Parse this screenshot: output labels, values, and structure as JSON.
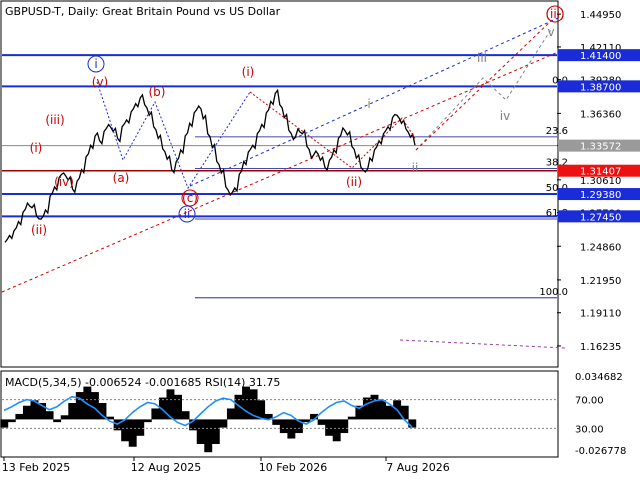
{
  "window": {
    "symbol_title": "GBPUSD-T, Daily:  Great Britain Pound vs US Dollar",
    "indicator_title": "MACD(5,34,5) -0.006524 -0.001685 RSI(14) 31.75"
  },
  "colors": {
    "background": "#ffffff",
    "frame": "#000000",
    "price_line": "#000000",
    "blue_wave": "#1a2bd8",
    "red_wave": "#cc0000",
    "gray_wave": "#808080",
    "fib_line": "#0a0a8a",
    "red_tag": "#ee1111",
    "macd_bars": "#000000",
    "rsi_line": "#1e90ff"
  },
  "chart_data": [
    {
      "type": "line",
      "name": "price",
      "y_axis_ticks": [
        "1.44950",
        "1.42110",
        "1.39280",
        "1.36360",
        "1.33570",
        "1.30610",
        "1.27780",
        "1.24860",
        "1.21950",
        "1.19110",
        "1.16235"
      ],
      "y_axis_range": [
        1.145,
        1.46
      ],
      "x_axis_ticks": [
        "13 Feb 2025",
        "12 Aug 2025",
        "10 Feb 2026",
        "7 Aug 2026"
      ],
      "price_tags": [
        {
          "value": 1.414,
          "label": "1.41400",
          "style": "blue"
        },
        {
          "value": 1.387,
          "label": "1.38700",
          "style": "blue"
        },
        {
          "value": 1.3357,
          "label": "1.33572",
          "style": "gray"
        },
        {
          "value": 1.314,
          "label": "1.31407",
          "style": "red"
        },
        {
          "value": 1.2938,
          "label": "1.29380",
          "style": "blue"
        },
        {
          "value": 1.2745,
          "label": "1.27450",
          "style": "blue"
        }
      ],
      "fib_levels": [
        {
          "label": "0.0",
          "value": 1.387
        },
        {
          "label": "23.6",
          "value": 1.3433
        },
        {
          "label": "38.2",
          "value": 1.316
        },
        {
          "label": "50.0",
          "value": 1.2938
        },
        {
          "label": "61.8",
          "value": 1.2722
        },
        {
          "label": "100.0",
          "value": 1.204
        }
      ],
      "wave_labels": [
        {
          "text": "i",
          "style": "blue-circle"
        },
        {
          "text": "ii",
          "style": "blue-circle"
        },
        {
          "text": "(i)",
          "style": "red"
        },
        {
          "text": "(ii)",
          "style": "red"
        },
        {
          "text": "(iii)",
          "style": "red"
        },
        {
          "text": "(iv)",
          "style": "red"
        },
        {
          "text": "(v)",
          "style": "red"
        },
        {
          "text": "(a)",
          "style": "red"
        },
        {
          "text": "(b)",
          "style": "red"
        },
        {
          "text": "(c)",
          "style": "red"
        },
        {
          "text": "(i)",
          "style": "red"
        },
        {
          "text": "(ii)",
          "style": "red"
        },
        {
          "text": "(iii)",
          "style": "red"
        },
        {
          "text": "i",
          "style": "gray"
        },
        {
          "text": "ii",
          "style": "gray"
        },
        {
          "text": "iii",
          "style": "gray"
        },
        {
          "text": "iv",
          "style": "gray"
        },
        {
          "text": "v",
          "style": "gray"
        }
      ],
      "series_close": [
        1.252,
        1.258,
        1.262,
        1.27,
        1.278,
        1.286,
        1.282,
        1.275,
        1.272,
        1.28,
        1.292,
        1.3,
        1.308,
        1.312,
        1.306,
        1.298,
        1.305,
        1.315,
        1.326,
        1.336,
        1.344,
        1.34,
        1.348,
        1.354,
        1.348,
        1.342,
        1.352,
        1.358,
        1.365,
        1.372,
        1.377,
        1.371,
        1.362,
        1.352,
        1.342,
        1.333,
        1.324,
        1.315,
        1.322,
        1.332,
        1.344,
        1.355,
        1.364,
        1.37,
        1.359,
        1.346,
        1.334,
        1.322,
        1.312,
        1.3,
        1.293,
        1.299,
        1.311,
        1.322,
        1.33,
        1.336,
        1.346,
        1.354,
        1.364,
        1.374,
        1.381,
        1.371,
        1.36,
        1.349,
        1.341,
        1.35,
        1.346,
        1.335,
        1.325,
        1.331,
        1.323,
        1.317,
        1.323,
        1.332,
        1.342,
        1.351,
        1.345,
        1.335,
        1.325,
        1.317,
        1.313,
        1.325,
        1.332,
        1.34,
        1.346,
        1.352,
        1.36,
        1.362,
        1.355,
        1.35,
        1.343,
        1.336
      ],
      "ylim": [
        1.145,
        1.46
      ]
    },
    {
      "type": "bar",
      "name": "MACD(5,34,5) + RSI(14)",
      "y_axis_ticks": [
        "0.034682",
        "70.00",
        "30.00",
        "-0.026778"
      ],
      "histogram": [
        -0.006,
        -0.002,
        0.004,
        0.01,
        0.014,
        0.012,
        0.006,
        -0.002,
        0.003,
        0.012,
        0.02,
        0.024,
        0.02,
        0.012,
        0.002,
        -0.008,
        -0.016,
        -0.02,
        -0.012,
        -0.002,
        0.008,
        0.016,
        0.022,
        0.018,
        0.006,
        -0.008,
        -0.018,
        -0.024,
        -0.018,
        -0.006,
        0.008,
        0.018,
        0.024,
        0.022,
        0.014,
        0.004,
        -0.004,
        -0.01,
        -0.014,
        -0.01,
        -0.002,
        0.004,
        -0.004,
        -0.012,
        -0.016,
        -0.01,
        0.002,
        0.01,
        0.016,
        0.018,
        0.014,
        0.01,
        0.014,
        0.01,
        -0.006
      ],
      "rsi": [
        55,
        60,
        66,
        70,
        68,
        62,
        56,
        60,
        68,
        74,
        72,
        64,
        58,
        48,
        40,
        36,
        42,
        52,
        60,
        66,
        64,
        56,
        46,
        38,
        34,
        40,
        50,
        60,
        68,
        72,
        70,
        62,
        54,
        48,
        44,
        42,
        46,
        52,
        48,
        40,
        36,
        42,
        52,
        60,
        66,
        68,
        62,
        58,
        64,
        68,
        70,
        64,
        56,
        42,
        32
      ],
      "ylim": [
        -0.026778,
        0.034682
      ]
    }
  ]
}
